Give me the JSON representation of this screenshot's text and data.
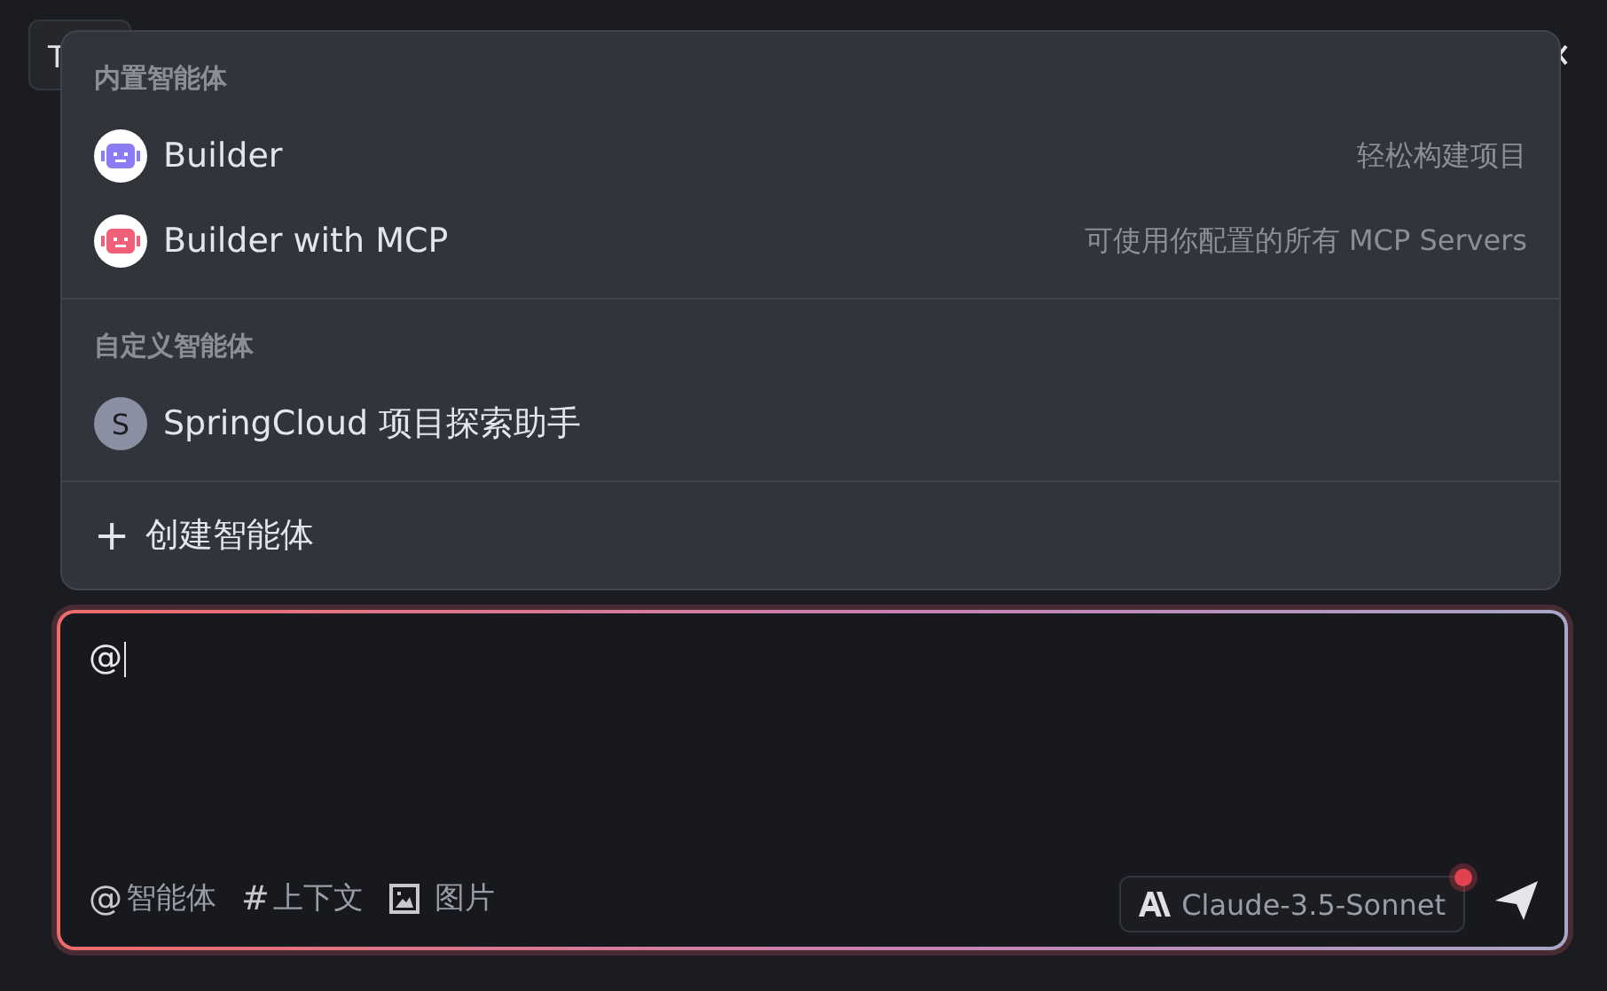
{
  "background": {
    "tab_text": "T"
  },
  "menu": {
    "sections": [
      {
        "heading": "内置智能体",
        "items": [
          {
            "kind": "builtin",
            "name": "Builder",
            "description": "轻松构建项目",
            "color": "#8b7cf6"
          },
          {
            "kind": "builtin",
            "name": "Builder with MCP",
            "description": "可使用你配置的所有 MCP Servers",
            "color": "#f0607a"
          }
        ]
      },
      {
        "heading": "自定义智能体",
        "items": [
          {
            "kind": "custom",
            "avatar": "S",
            "name": "SpringCloud 项目探索助手"
          }
        ]
      }
    ],
    "create": {
      "icon": "+",
      "label": "创建智能体"
    }
  },
  "composer": {
    "value": "@",
    "tools": [
      {
        "kind": "char",
        "icon": "@",
        "label": "智能体"
      },
      {
        "kind": "char",
        "icon": "#",
        "label": "上下文"
      },
      {
        "kind": "image",
        "label": "图片"
      }
    ],
    "model": "Claude-3.5-Sonnet",
    "model_notice": true
  }
}
